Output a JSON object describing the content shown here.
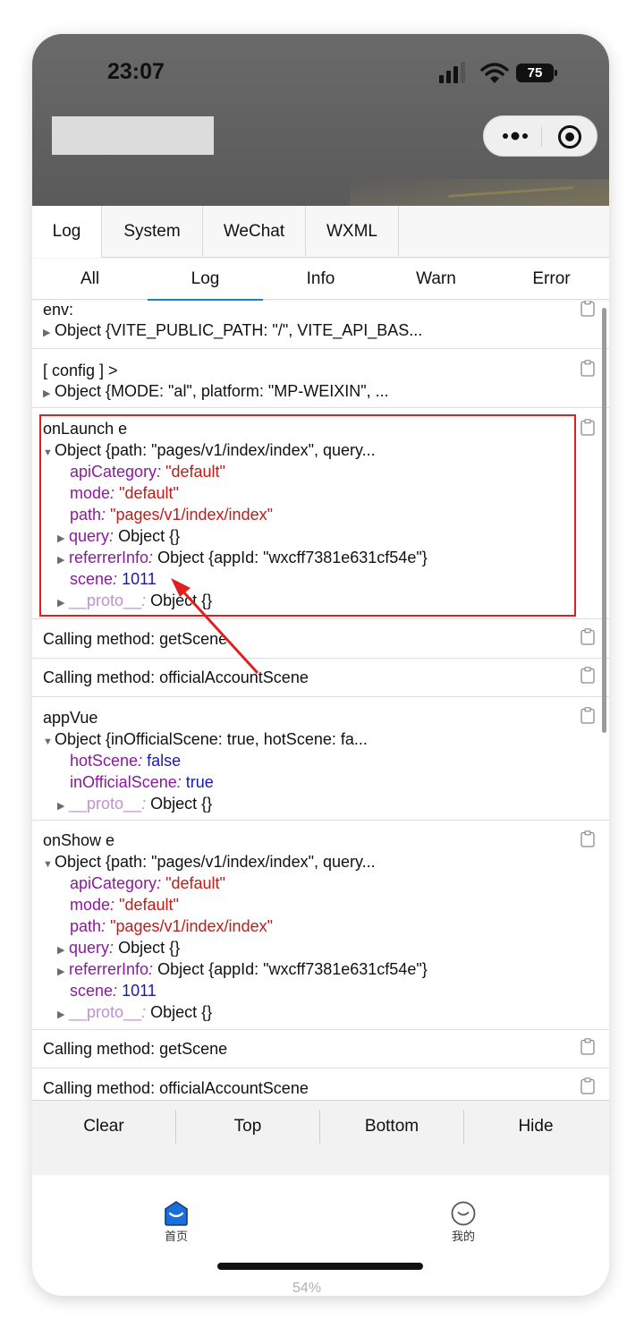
{
  "status_bar": {
    "time": "23:07",
    "battery": "75"
  },
  "tabs_top": [
    "Log",
    "System",
    "WeChat",
    "WXML"
  ],
  "filter_tabs": [
    "All",
    "Log",
    "Info",
    "Warn",
    "Error"
  ],
  "logs": {
    "env": {
      "title": "env:",
      "summary": "Object {VITE_PUBLIC_PATH: \"/\", VITE_API_BAS..."
    },
    "config": {
      "title": "[ config ] >",
      "summary": "Object {MODE: \"al\", platform: \"MP-WEIXIN\", ..."
    },
    "onlaunch": {
      "title": "onLaunch e",
      "summary": "Object {path: \"pages/v1/index/index\", query...",
      "api_key": "apiCategory",
      "api_val": "\"default\"",
      "mode_key": "mode",
      "mode_val": "\"default\"",
      "path_key": "path",
      "path_val": "\"pages/v1/index/index\"",
      "query_key": "query",
      "query_val": "Object {}",
      "ref_key": "referrerInfo",
      "ref_val": "Object {appId: \"wxcff7381e631cf54e\"}",
      "scene_key": "scene",
      "scene_val": "1011",
      "proto_key": "__proto__",
      "proto_val": "Object {}"
    },
    "call1": "Calling method: getScene",
    "call2": "Calling method: officialAccountScene",
    "appvue": {
      "title": "appVue",
      "summary": "Object {inOfficialScene: true, hotScene: fa...",
      "hot_key": "hotScene",
      "hot_val": "false",
      "in_key": "inOfficialScene",
      "in_val": "true",
      "proto_key": "__proto__",
      "proto_val": "Object {}"
    },
    "onshow": {
      "title": "onShow e",
      "summary": "Object {path: \"pages/v1/index/index\", query...",
      "api_key": "apiCategory",
      "api_val": "\"default\"",
      "mode_key": "mode",
      "mode_val": "\"default\"",
      "path_key": "path",
      "path_val": "\"pages/v1/index/index\"",
      "query_key": "query",
      "query_val": "Object {}",
      "ref_key": "referrerInfo",
      "ref_val": "Object {appId: \"wxcff7381e631cf54e\"}",
      "scene_key": "scene",
      "scene_val": "1011",
      "proto_key": "__proto__",
      "proto_val": "Object {}"
    },
    "call3": "Calling method: getScene",
    "call4": "Calling method: officialAccountScene"
  },
  "buttons": {
    "clear": "Clear",
    "top": "Top",
    "bottom": "Bottom",
    "hide": "Hide"
  },
  "tabbar": {
    "home": "首页",
    "mine": "我的"
  },
  "zoom": "54%",
  "colors": {
    "highlight": "#e02020",
    "active_tab": "#1a7fd4",
    "home_icon": "#1a6fd8"
  },
  "icons": [
    "signal-icon",
    "wifi-icon",
    "battery-icon",
    "more-icon",
    "target-icon",
    "clipboard-icon",
    "home-icon",
    "smile-icon"
  ]
}
